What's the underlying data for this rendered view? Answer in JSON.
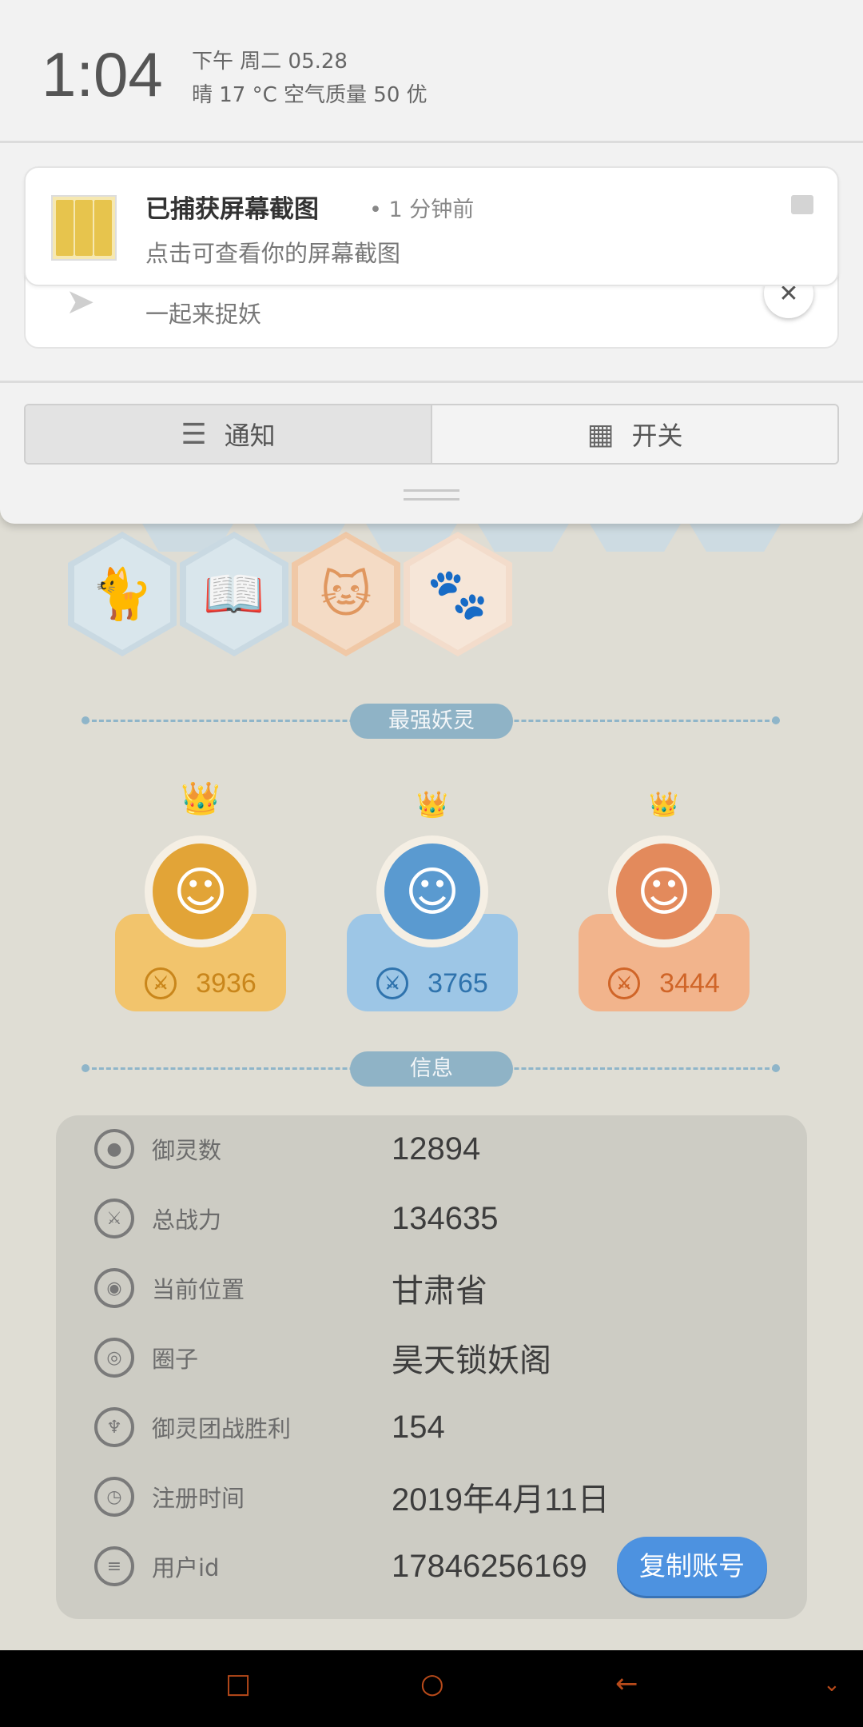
{
  "status": {
    "time": "1:04",
    "date": "下午 周二   05.28",
    "weather": "晴    17 °C    空气质量 50    优"
  },
  "notifications": {
    "screenshot": {
      "title": "已捕获屏幕截图",
      "meta": "• 1 分钟前",
      "text": "点击可查看你的屏幕截图",
      "icon": "image-icon"
    },
    "app": {
      "text": "一起来捉妖",
      "close": "✕"
    }
  },
  "tabs": [
    {
      "label": "通知",
      "icon": "list-icon",
      "active": true
    },
    {
      "label": "开关",
      "icon": "grid-icon",
      "active": false
    }
  ],
  "sections": {
    "strongest": "最强妖灵",
    "info": "信息"
  },
  "heroes": [
    {
      "power": "3936",
      "theme": "gold"
    },
    {
      "power": "3765",
      "theme": "blue"
    },
    {
      "power": "3444",
      "theme": "peach"
    }
  ],
  "info": [
    {
      "label": "御灵数",
      "value": "12894",
      "icon": "spirit-icon"
    },
    {
      "label": "总战力",
      "value": "134635",
      "icon": "sword-icon"
    },
    {
      "label": "当前位置",
      "value": "甘肃省",
      "icon": "location-icon"
    },
    {
      "label": "圈子",
      "value": "昊天锁妖阁",
      "icon": "circle-icon"
    },
    {
      "label": "御灵团战胜利",
      "value": "154",
      "icon": "trophy-icon"
    },
    {
      "label": "注册时间",
      "value": "2019年4月11日",
      "icon": "clock-icon"
    },
    {
      "label": "用户id",
      "value": "17846256169",
      "icon": "id-icon"
    }
  ],
  "copy_button": "复制账号",
  "colors": {
    "accent_blue": "#4d92e0",
    "gold": "#f2c46c",
    "blue": "#9dc6e6",
    "peach": "#f2b48c"
  }
}
